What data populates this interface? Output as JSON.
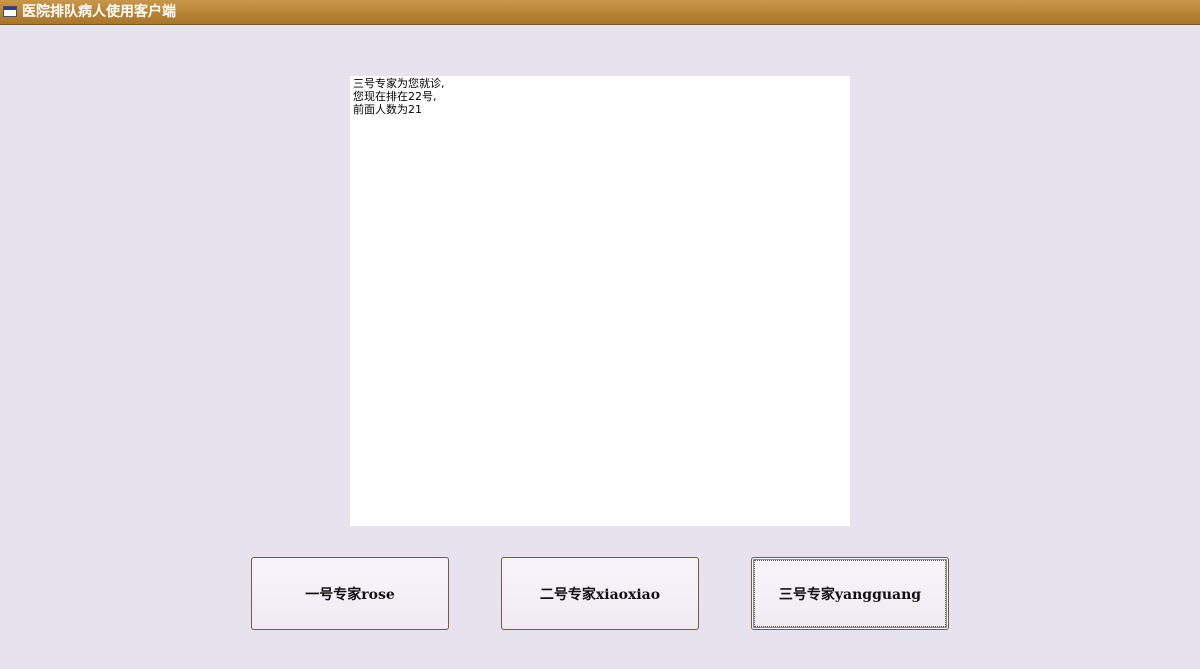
{
  "window": {
    "title": "医院排队病人使用客户端",
    "icon": "window-icon"
  },
  "status_text": {
    "lines": [
      "三号专家为您就诊,",
      "您现在排在22号,",
      "前面人数为21"
    ]
  },
  "buttons": [
    {
      "label": "一号专家rose"
    },
    {
      "label": "二号专家xiaoxiao"
    },
    {
      "label": "三号专家yangguang"
    }
  ],
  "colors": {
    "background": "#e6e2ee",
    "titlebar": "#b88435",
    "button_border": "#7a5a3c"
  }
}
